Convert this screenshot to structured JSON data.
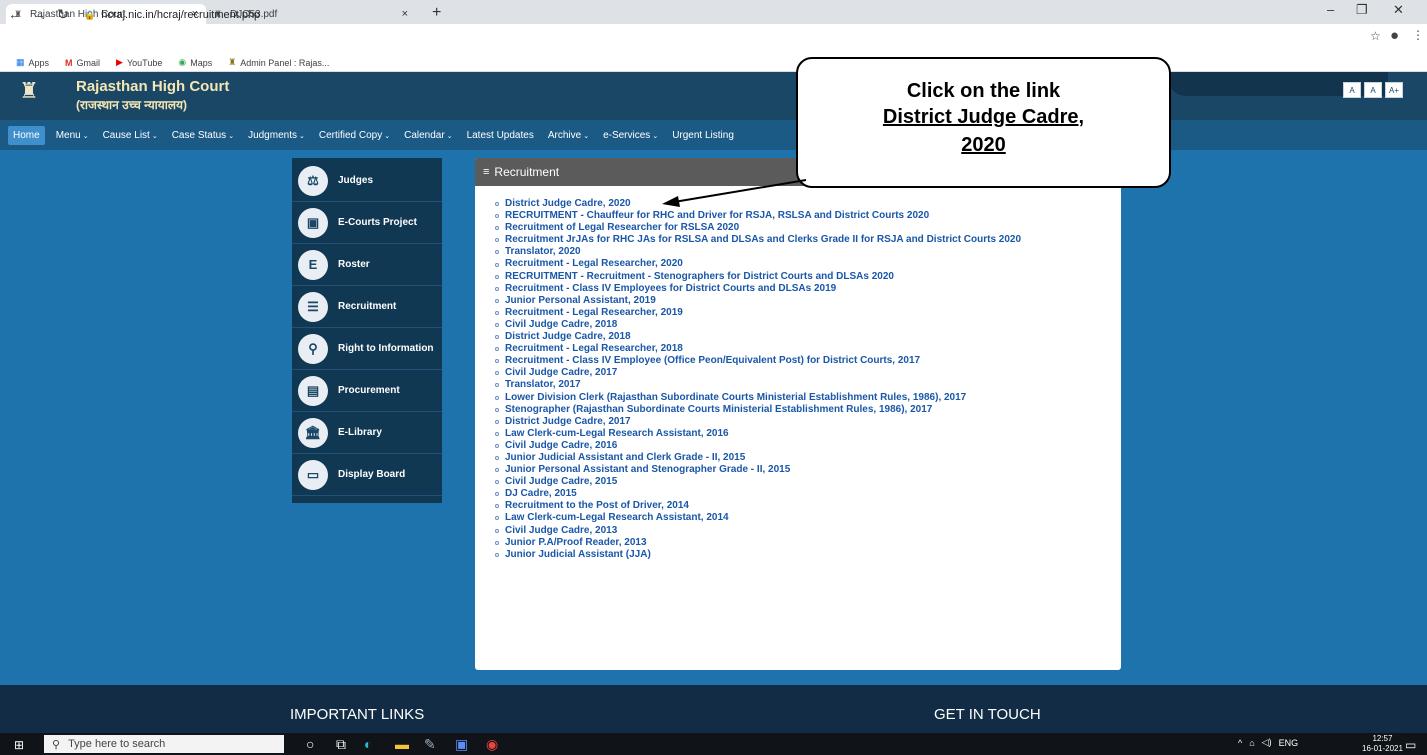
{
  "browser": {
    "tabs": [
      {
        "title": "Rajasthan High Court",
        "active": true
      },
      {
        "title": "DJC53.pdf",
        "active": false
      }
    ],
    "new_tab": "+",
    "window_controls": {
      "minimize": "–",
      "restore": "❐",
      "close": "✕"
    },
    "url": "hcraj.nic.in/hcraj/recruitment.php",
    "bookmarks": [
      "Apps",
      "Gmail",
      "YouTube",
      "Maps",
      "Admin Panel : Rajas..."
    ]
  },
  "site": {
    "name": "Rajasthan High Court",
    "subtitle": "(राजस्थान उच्च न्यायालय)",
    "font_buttons": [
      "A",
      "A",
      "A+"
    ],
    "nav": [
      "Home",
      "Menu",
      "Cause List",
      "Case Status",
      "Judgments",
      "Certified Copy",
      "Calendar",
      "Latest Updates",
      "Archive",
      "e-Services",
      "Urgent Listing"
    ],
    "nav_with_caret": [
      false,
      true,
      true,
      true,
      true,
      true,
      true,
      false,
      true,
      true,
      false
    ]
  },
  "sidebar": {
    "items": [
      {
        "label": "Judges",
        "icon": "gavel-icon",
        "glyph": "⚖"
      },
      {
        "label": "E-Courts Project",
        "icon": "e-courts-icon",
        "glyph": "▣"
      },
      {
        "label": "Roster",
        "icon": "roster-icon",
        "glyph": "E"
      },
      {
        "label": "Recruitment",
        "icon": "recruitment-icon",
        "glyph": "☰"
      },
      {
        "label": "Right to Information",
        "icon": "search-icon",
        "glyph": "⚲"
      },
      {
        "label": "Procurement",
        "icon": "procurement-icon",
        "glyph": "▤"
      },
      {
        "label": "E-Library",
        "icon": "library-icon",
        "glyph": "🏛"
      },
      {
        "label": "Display Board",
        "icon": "monitor-icon",
        "glyph": "▭"
      }
    ]
  },
  "recruitment": {
    "heading": "Recruitment",
    "items": [
      "District Judge Cadre, 2020",
      "RECRUITMENT - Chauffeur for RHC and Driver for RSJA, RSLSA and District Courts 2020",
      "Recruitment of Legal Researcher for RSLSA 2020",
      "Recruitment JrJAs for RHC JAs for RSLSA and DLSAs and Clerks Grade II for RSJA and District Courts 2020",
      "Translator, 2020",
      "Recruitment - Legal Researcher, 2020",
      "RECRUITMENT - Recruitment - Stenographers for District Courts and DLSAs 2020",
      "Recruitment - Class IV Employees for District Courts and DLSAs 2019",
      "Junior Personal Assistant, 2019",
      "Recruitment - Legal Researcher, 2019",
      "Civil Judge Cadre, 2018",
      "District Judge Cadre, 2018",
      "Recruitment - Legal Researcher, 2018",
      "Recruitment - Class IV Employee (Office Peon/Equivalent Post) for District Courts, 2017",
      "Civil Judge Cadre, 2017",
      "Translator, 2017",
      "Lower Division Clerk (Rajasthan Subordinate Courts Ministerial Establishment Rules, 1986), 2017",
      "Stenographer (Rajasthan Subordinate Courts Ministerial Establishment Rules, 1986), 2017",
      "District Judge Cadre, 2017",
      "Law Clerk-cum-Legal Research Assistant, 2016",
      "Civil Judge Cadre, 2016",
      "Junior Judicial Assistant and Clerk Grade - II, 2015",
      "Junior Personal Assistant and Stenographer Grade - II, 2015",
      "Civil Judge Cadre, 2015",
      "DJ Cadre, 2015",
      "Recruitment to the Post of Driver, 2014",
      "Law Clerk-cum-Legal Research Assistant, 2014",
      "Civil Judge Cadre, 2013",
      "Junior P.A/Proof Reader, 2013",
      "Junior Judicial Assistant (JJA)"
    ]
  },
  "callout": {
    "line1": "Click on the link",
    "line2": "District Judge Cadre,",
    "line3": "2020"
  },
  "footer": {
    "important_links": "IMPORTANT LINKS",
    "get_in_touch": "GET IN TOUCH"
  },
  "taskbar": {
    "search_placeholder": "Type here to search",
    "lang": "ENG",
    "time": "12:57",
    "date": "16-01-2021"
  }
}
